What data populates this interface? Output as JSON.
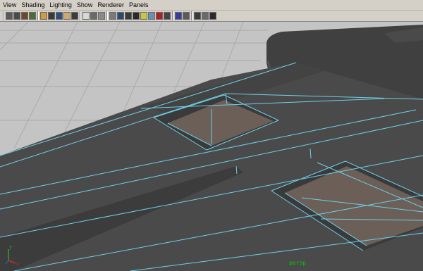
{
  "menu": {
    "items": [
      "View",
      "Shading",
      "Lighting",
      "Show",
      "Renderer",
      "Panels"
    ]
  },
  "toolbar": {
    "groups": [
      [
        {
          "icon": "camera-select-icon",
          "color": "#5a5a5a"
        },
        {
          "icon": "camera-attributes-icon",
          "color": "#4a4a4a"
        },
        {
          "icon": "bookmark-icon",
          "color": "#6b4a2a"
        },
        {
          "icon": "image-plane-icon",
          "color": "#4c6b3c"
        }
      ],
      [
        {
          "icon": "grid-icon",
          "color": "#d29a3a"
        },
        {
          "icon": "film-gate-icon",
          "color": "#3a3a3a"
        },
        {
          "icon": "resolution-gate-icon",
          "color": "#2f4f7a"
        },
        {
          "icon": "gate-mask-icon",
          "color": "#cda870"
        },
        {
          "icon": "field-chart-icon",
          "color": "#3c3c3c"
        }
      ],
      [
        {
          "icon": "safe-action-icon",
          "color": "#d8d8d8"
        },
        {
          "icon": "safe-title-icon",
          "color": "#6a6a6a"
        },
        {
          "icon": "wireframe-icon",
          "color": "#8a8a8a"
        }
      ],
      [
        {
          "icon": "smooth-shade-icon",
          "color": "#7a7a7a"
        },
        {
          "icon": "shaded-wireframe-icon",
          "color": "#2a4a6a"
        },
        {
          "icon": "flat-shade-icon",
          "color": "#3a3a3a"
        },
        {
          "icon": "textured-icon",
          "color": "#2a2a2a"
        },
        {
          "icon": "lighting-icon",
          "color": "#c8c840"
        },
        {
          "icon": "shadows-icon",
          "color": "#6a8fb0"
        },
        {
          "icon": "screen-space-ao-icon",
          "color": "#b02020"
        },
        {
          "icon": "motion-blur-icon",
          "color": "#444444"
        }
      ],
      [
        {
          "icon": "isolate-select-icon",
          "color": "#3a3aa0"
        },
        {
          "icon": "xray-icon",
          "color": "#5a5a5a"
        }
      ],
      [
        {
          "icon": "xray-joints-icon",
          "color": "#3a3a3a"
        },
        {
          "icon": "xray-components-icon",
          "color": "#6a6a6a"
        },
        {
          "icon": "default-material-icon",
          "color": "#2a2a2a"
        }
      ]
    ]
  },
  "viewport": {
    "camera_name": "persp",
    "axis_labels": {
      "y": "y",
      "x": "x"
    },
    "colors": {
      "grid_bg": "#c4c4c4",
      "grid_line": "#a8a8a8",
      "mesh_face": "#4a4a4a",
      "mesh_side": "#3a3a3a",
      "wire": "#6fd0ea",
      "pocket_face": "#6b5f58",
      "sofa": "#404040"
    }
  }
}
